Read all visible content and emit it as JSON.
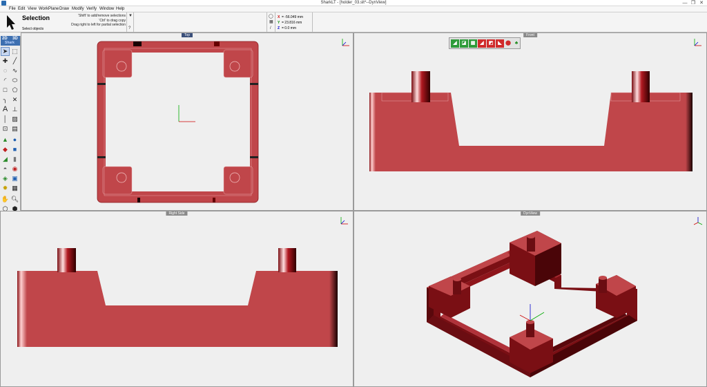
{
  "window": {
    "title": "SharkLT - [holder_03.slt*--DynView]",
    "controls": [
      "—",
      "❐",
      "✕"
    ]
  },
  "menu": [
    "File",
    "Edit",
    "View",
    "WorkPlane",
    "Draw",
    "Modify",
    "Verify",
    "Window",
    "Help"
  ],
  "prompt": {
    "tool_name": "Selection",
    "hint": "Select objects",
    "tips": [
      "'Shift' to add/remove selections",
      "'Ctrl' to drag copy",
      "Drag right to left for partial selection"
    ]
  },
  "coords": {
    "x_label": "X",
    "x_value": "= -56.049 mm",
    "y_label": "Y",
    "y_value": "= 23.816 mm",
    "z_label": "Z",
    "z_value": "= 0.0 mm"
  },
  "toolbar": {
    "mode_2d": "2D",
    "mode_3d": "3D",
    "mode_sub": "Shark"
  },
  "viewports": {
    "top": {
      "label": "Top"
    },
    "front": {
      "label": "Front"
    },
    "right": {
      "label": "Right Side"
    },
    "dyn": {
      "label": "DynView"
    }
  },
  "colors": {
    "part_red": "#c0464a",
    "part_dark": "#6b0d12",
    "active_label": "#3a4f7a"
  }
}
